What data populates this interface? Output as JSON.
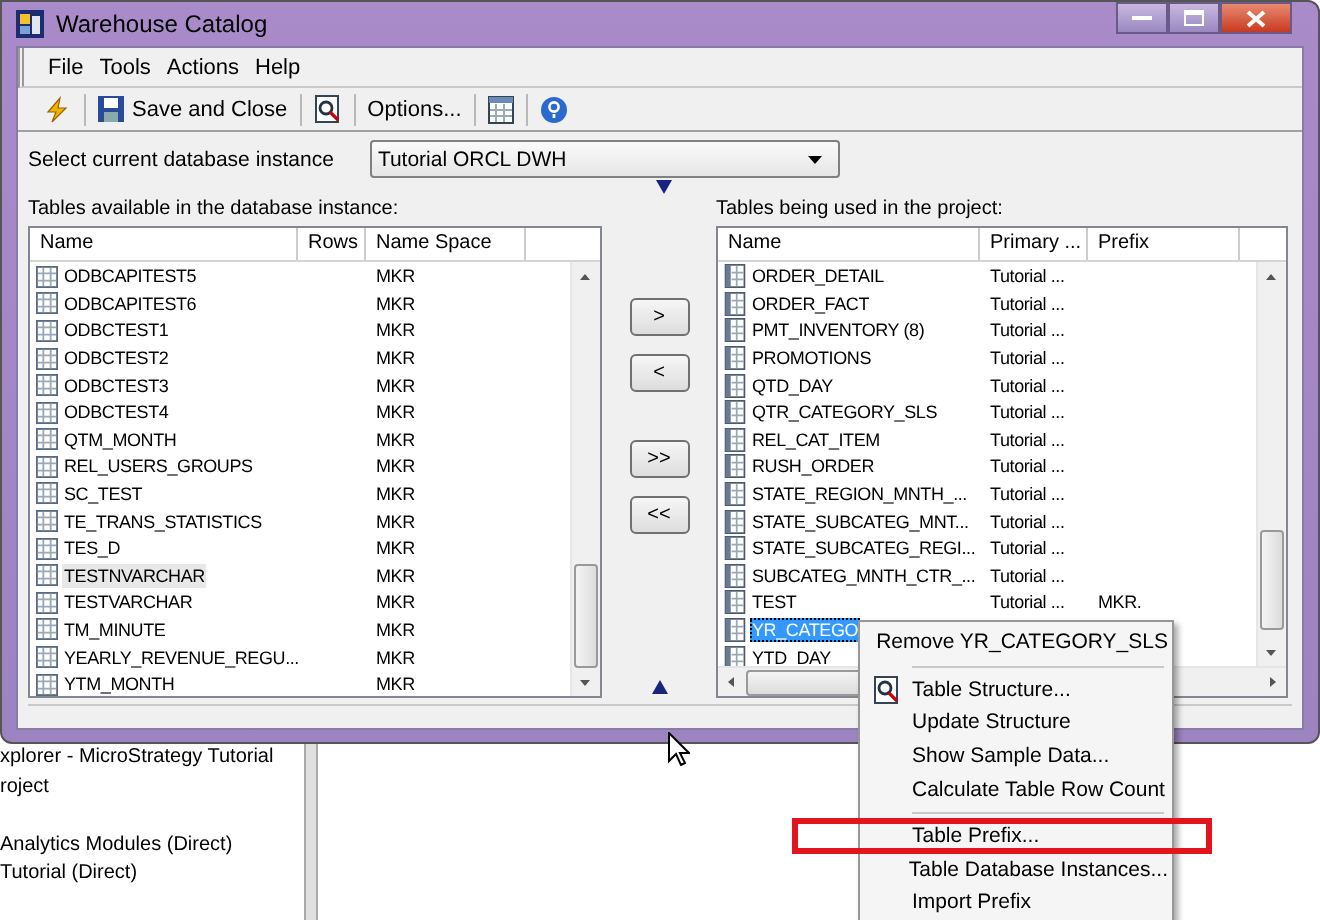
{
  "window": {
    "title": "Warehouse Catalog"
  },
  "menu": [
    "File",
    "Tools",
    "Actions",
    "Help"
  ],
  "toolbar": {
    "save_label": "Save and Close",
    "options_label": "Options..."
  },
  "instance": {
    "label": "Select current database instance",
    "value": "Tutorial ORCL DWH"
  },
  "available": {
    "label": "Tables available in the database instance:",
    "columns": [
      "Name",
      "Rows",
      "Name Space"
    ],
    "rows": [
      {
        "name": "ODBCAPITEST5",
        "namespace": "MKR",
        "hovered": false
      },
      {
        "name": "ODBCAPITEST6",
        "namespace": "MKR",
        "hovered": false
      },
      {
        "name": "ODBCTEST1",
        "namespace": "MKR",
        "hovered": false
      },
      {
        "name": "ODBCTEST2",
        "namespace": "MKR",
        "hovered": false
      },
      {
        "name": "ODBCTEST3",
        "namespace": "MKR",
        "hovered": false
      },
      {
        "name": "ODBCTEST4",
        "namespace": "MKR",
        "hovered": false
      },
      {
        "name": "QTM_MONTH",
        "namespace": "MKR",
        "hovered": false
      },
      {
        "name": "REL_USERS_GROUPS",
        "namespace": "MKR",
        "hovered": false
      },
      {
        "name": "SC_TEST",
        "namespace": "MKR",
        "hovered": false
      },
      {
        "name": "TE_TRANS_STATISTICS",
        "namespace": "MKR",
        "hovered": false
      },
      {
        "name": "TES_D",
        "namespace": "MKR",
        "hovered": false
      },
      {
        "name": "TESTNVARCHAR",
        "namespace": "MKR",
        "hovered": true
      },
      {
        "name": "TESTVARCHAR",
        "namespace": "MKR",
        "hovered": false
      },
      {
        "name": "TM_MINUTE",
        "namespace": "MKR",
        "hovered": false
      },
      {
        "name": "YEARLY_REVENUE_REGU...",
        "namespace": "MKR",
        "hovered": false
      },
      {
        "name": "YTM_MONTH",
        "namespace": "MKR",
        "hovered": false
      }
    ]
  },
  "move_buttons": [
    ">",
    "<",
    ">>",
    "<<"
  ],
  "used": {
    "label": "Tables being used in the project:",
    "columns": [
      "Name",
      "Primary ...",
      "Prefix"
    ],
    "rows": [
      {
        "name": "ORDER_DETAIL",
        "primary": "Tutorial ...",
        "selected": false
      },
      {
        "name": "ORDER_FACT",
        "primary": "Tutorial ...",
        "selected": false
      },
      {
        "name": "PMT_INVENTORY (8)",
        "primary": "Tutorial ...",
        "selected": false
      },
      {
        "name": "PROMOTIONS",
        "primary": "Tutorial ...",
        "selected": false
      },
      {
        "name": "QTD_DAY",
        "primary": "Tutorial ...",
        "selected": false
      },
      {
        "name": "QTR_CATEGORY_SLS",
        "primary": "Tutorial ...",
        "selected": false
      },
      {
        "name": "REL_CAT_ITEM",
        "primary": "Tutorial ...",
        "selected": false
      },
      {
        "name": "RUSH_ORDER",
        "primary": "Tutorial ...",
        "selected": false
      },
      {
        "name": "STATE_REGION_MNTH_...",
        "primary": "Tutorial ...",
        "selected": false
      },
      {
        "name": "STATE_SUBCATEG_MNT...",
        "primary": "Tutorial ...",
        "selected": false
      },
      {
        "name": "STATE_SUBCATEG_REGI...",
        "primary": "Tutorial ...",
        "selected": false
      },
      {
        "name": "SUBCATEG_MNTH_CTR_...",
        "primary": "Tutorial ...",
        "selected": false
      },
      {
        "name": "TEST",
        "primary": "Tutorial ...",
        "prefix": "MKR.",
        "selected": false
      },
      {
        "name": "YR_CATEGO",
        "selected": true
      },
      {
        "name": "YTD_DAY",
        "selected": false
      }
    ]
  },
  "context_menu": {
    "groups": [
      [
        {
          "label": "Remove YR_CATEGORY_SLS",
          "kind": "plain",
          "highlighted": false
        }
      ],
      [
        {
          "label": "Table Structure...",
          "kind": "icon",
          "highlighted": false
        },
        {
          "label": "Update Structure",
          "kind": "plain",
          "highlighted": false
        },
        {
          "label": "Show Sample Data...",
          "kind": "plain",
          "highlighted": false
        },
        {
          "label": "Calculate Table Row Count",
          "kind": "plain",
          "highlighted": false
        }
      ],
      [
        {
          "label": "Table Prefix...",
          "kind": "plain",
          "highlighted": true
        },
        {
          "label": "Table Database Instances...",
          "kind": "plain",
          "highlighted": false
        },
        {
          "label": "Import Prefix",
          "kind": "plain",
          "highlighted": false
        }
      ]
    ]
  },
  "explorer": {
    "tree": [
      "xplorer - MicroStrategy Tutorial",
      "roject",
      "Analytics Modules (Direct)",
      "Tutorial (Direct)"
    ]
  }
}
